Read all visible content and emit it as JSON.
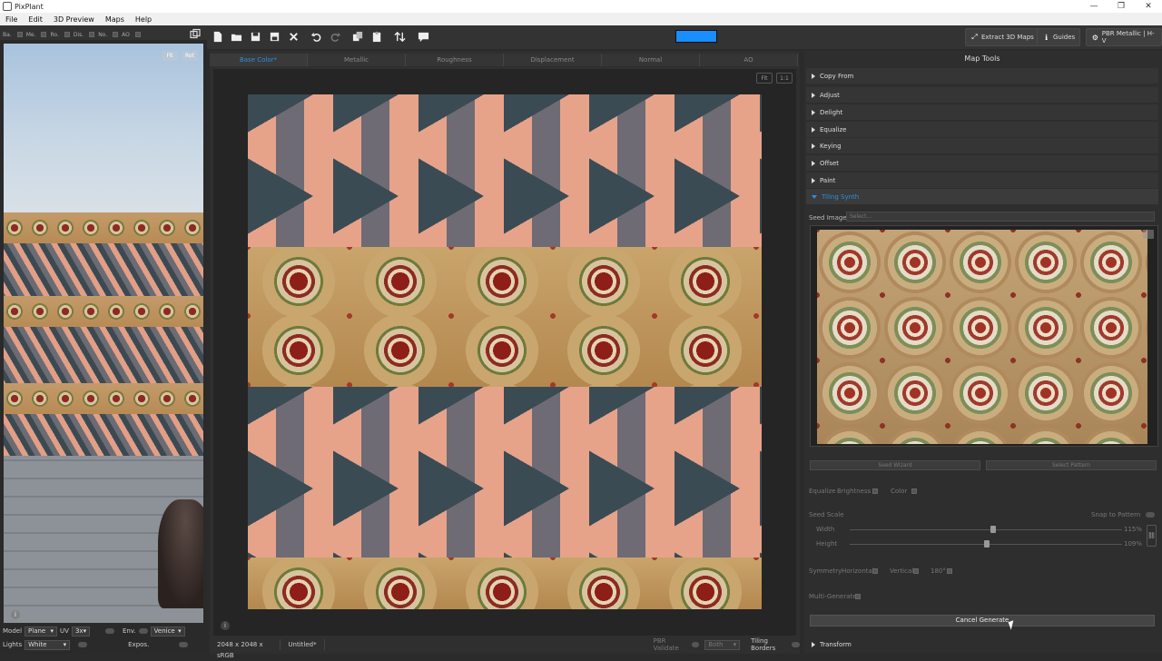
{
  "window": {
    "title": "PixPlant",
    "minimize": "—",
    "restore": "❐",
    "close": "✕"
  },
  "menu": {
    "items": [
      "File",
      "Edit",
      "3D Preview",
      "Maps",
      "Help"
    ]
  },
  "left_toolbar": {
    "items": [
      "Ba.",
      "Me.",
      "Ro.",
      "Dis.",
      "No.",
      "AO"
    ]
  },
  "toolbar": {
    "progress_fraction": 1.0,
    "extract_label": "Extract 3D Maps",
    "guides_label": "Guides",
    "pbr_label": "PBR Metallic | H-V"
  },
  "preview": {
    "fit_label": "Fit",
    "rot_label": "Rot",
    "info_label": "i",
    "model_label": "Model",
    "model_value": "Plane",
    "uv_label": "UV",
    "uv_value": "3x",
    "env_label": "Env.",
    "env_value": "Venice",
    "lights_label": "Lights",
    "lights_value": "White",
    "expos_label": "Expos."
  },
  "tabs": [
    "Base Color*",
    "Metallic",
    "Roughness",
    "Displacement",
    "Normal",
    "AO"
  ],
  "canvas": {
    "fit_label": "Fit",
    "one_label": "1:1",
    "info_label": "i"
  },
  "status": {
    "resolution": "2048 x 2048 x sRGB",
    "file": "Untitled*",
    "pbr_validate": "PBR Validate",
    "both": "Both",
    "tiling_borders": "Tiling Borders"
  },
  "map_tools": {
    "title": "Map Tools",
    "sections": [
      "Copy From",
      "Adjust",
      "Delight",
      "Equalize",
      "Keying",
      "Offset",
      "Paint"
    ],
    "open_section": "Tiling Synth",
    "seed_image_label": "Seed Image",
    "seed_select_placeholder": "Select...",
    "seed_wizard": "Seed Wizard",
    "select_pattern": "Select Pattern",
    "equalize_label": "Equalize",
    "brightness_label": "Brightness",
    "color_label": "Color",
    "seed_scale_label": "Seed Scale",
    "snap_label": "Snap to Pattern",
    "width_label": "Width",
    "width_value": "115%",
    "height_label": "Height",
    "height_value": "109%",
    "symmetry_label": "Symmetry",
    "horizontal_label": "Horizontal",
    "vertical_label": "Vertical",
    "rot180_label": "180°",
    "multi_generate_label": "Multi-Generate",
    "cancel_generate": "Cancel Generate",
    "transform_label": "Transform"
  },
  "colors": {
    "accent": "#2e8fe0",
    "progress": "#1a8dff",
    "panel": "#2e2e2e"
  }
}
